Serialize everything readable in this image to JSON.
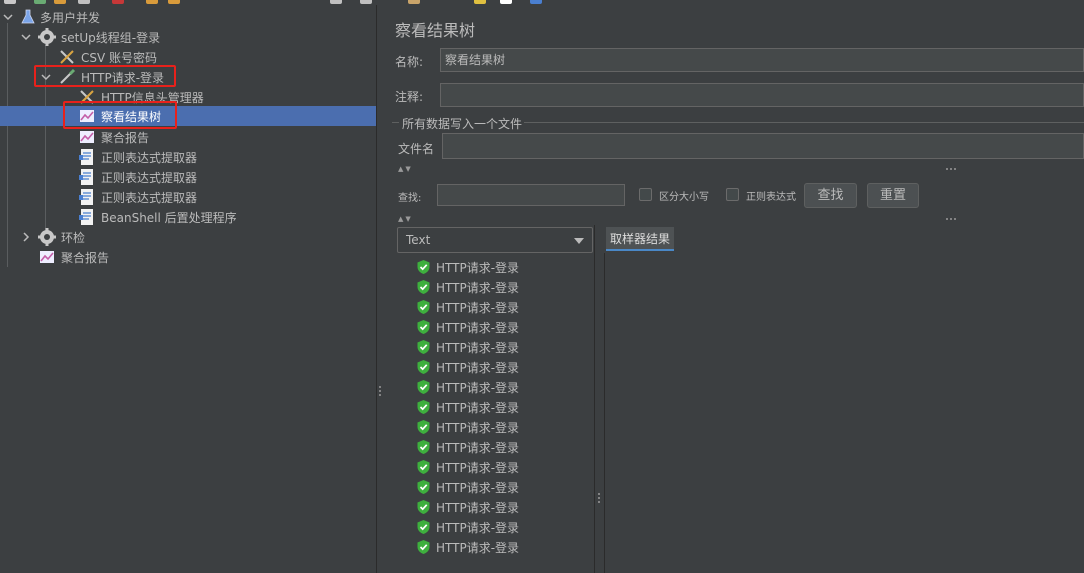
{
  "tree": {
    "items": [
      {
        "label": "多用户并发",
        "icon": "flask-icon"
      },
      {
        "label": "setUp线程组-登录",
        "icon": "gear-icon"
      },
      {
        "label": "CSV 账号密码",
        "icon": "tools-icon"
      },
      {
        "label": "HTTP请求-登录",
        "icon": "pipette-icon"
      },
      {
        "label": "HTTP信息头管理器",
        "icon": "tools-icon"
      },
      {
        "label": "察看结果树",
        "icon": "graph-icon"
      },
      {
        "label": "聚合报告",
        "icon": "graph-icon"
      },
      {
        "label": "正则表达式提取器",
        "icon": "document-icon"
      },
      {
        "label": "正则表达式提取器",
        "icon": "document-icon"
      },
      {
        "label": "正则表达式提取器",
        "icon": "document-icon"
      },
      {
        "label": "BeanShell 后置处理程序",
        "icon": "document-icon"
      },
      {
        "label": "环检",
        "icon": "gear-icon"
      },
      {
        "label": "聚合报告",
        "icon": "graph-icon"
      }
    ]
  },
  "panel": {
    "title": "察看结果树",
    "name_label": "名称:",
    "name_value": "察看结果树",
    "comment_label": "注释:",
    "comment_value": "",
    "group_label": "所有数据写入一个文件",
    "filename_label": "文件名",
    "filename_value": ""
  },
  "search": {
    "label": "查找:",
    "value": "",
    "case_label": "区分大小写",
    "regex_label": "正则表达式",
    "find_button": "查找",
    "reset_button": "重置"
  },
  "renderer": {
    "selected": "Text"
  },
  "results": {
    "items": [
      "HTTP请求-登录",
      "HTTP请求-登录",
      "HTTP请求-登录",
      "HTTP请求-登录",
      "HTTP请求-登录",
      "HTTP请求-登录",
      "HTTP请求-登录",
      "HTTP请求-登录",
      "HTTP请求-登录",
      "HTTP请求-登录",
      "HTTP请求-登录",
      "HTTP请求-登录",
      "HTTP请求-登录",
      "HTTP请求-登录",
      "HTTP请求-登录"
    ],
    "status_icon": "check-shield-icon",
    "status_color": "#3eaf3e"
  },
  "tabs": {
    "sampler_result": "取样器结果"
  },
  "colors": {
    "background": "#3c3f41",
    "selection": "#4b6eaf",
    "highlight_box": "#e8211b"
  }
}
